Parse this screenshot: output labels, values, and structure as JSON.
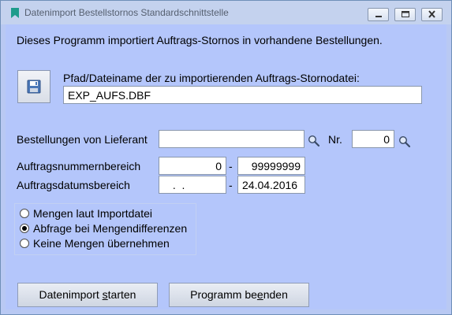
{
  "window": {
    "title": "Datenimport Bestellstornos Standardschnittstelle"
  },
  "intro_text": "Dieses Programm importiert Auftrags-Stornos in vorhandene Bestellungen.",
  "file": {
    "label": "Pfad/Dateiname der zu importierenden Auftrags-Stornodatei:",
    "value": "EXP_AUFS.DBF",
    "button_icon": "floppy-disk-icon"
  },
  "supplier": {
    "label": "Bestellungen von Lieferant",
    "value": "",
    "search_icon": "magnifier-icon",
    "nr_label": "Nr.",
    "nr_value": "0"
  },
  "order_range": {
    "label": "Auftragsnummernbereich",
    "from": "0",
    "separator": "-",
    "to": "99999999"
  },
  "date_range": {
    "label": "Auftragsdatumsbereich",
    "from": " .  .",
    "separator": "-",
    "to": "24.04.2016"
  },
  "quantity_options": [
    {
      "label": "Mengen laut Importdatei",
      "selected": false
    },
    {
      "label": "Abfrage bei Mengendifferenzen",
      "selected": true
    },
    {
      "label": "Keine Mengen übernehmen",
      "selected": false
    }
  ],
  "buttons": {
    "start_prefix": "Datenimport ",
    "start_key": "s",
    "start_suffix": "tarten",
    "end_prefix": "Programm be",
    "end_key": "e",
    "end_suffix": "nden"
  }
}
